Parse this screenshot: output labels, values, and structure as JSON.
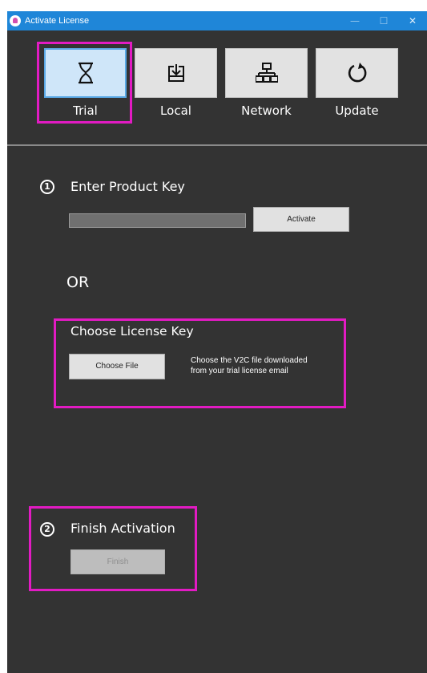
{
  "window": {
    "title": "Activate License",
    "controls": {
      "minimize": "—",
      "maximize": "☐",
      "close": "✕"
    }
  },
  "tabs": [
    {
      "label": "Trial",
      "icon": "hourglass-icon",
      "selected": true
    },
    {
      "label": "Local",
      "icon": "download-to-tray-icon",
      "selected": false
    },
    {
      "label": "Network",
      "icon": "network-icon",
      "selected": false
    },
    {
      "label": "Update",
      "icon": "refresh-icon",
      "selected": false
    }
  ],
  "step1": {
    "number": "1",
    "heading": "Enter Product Key",
    "product_key_value": "",
    "activate_label": "Activate"
  },
  "or_label": "OR",
  "license_key": {
    "heading": "Choose License Key",
    "choose_file_label": "Choose File",
    "hint_line1": "Choose the V2C file downloaded",
    "hint_line2": "from your trial license email"
  },
  "step2": {
    "number": "2",
    "heading": "Finish Activation",
    "finish_label": "Finish",
    "finish_enabled": false
  },
  "colors": {
    "window_background": "#333333",
    "titlebar": "#1f86d8",
    "selected_tab": "#cfe6f9",
    "highlight": "#e21bc3"
  }
}
